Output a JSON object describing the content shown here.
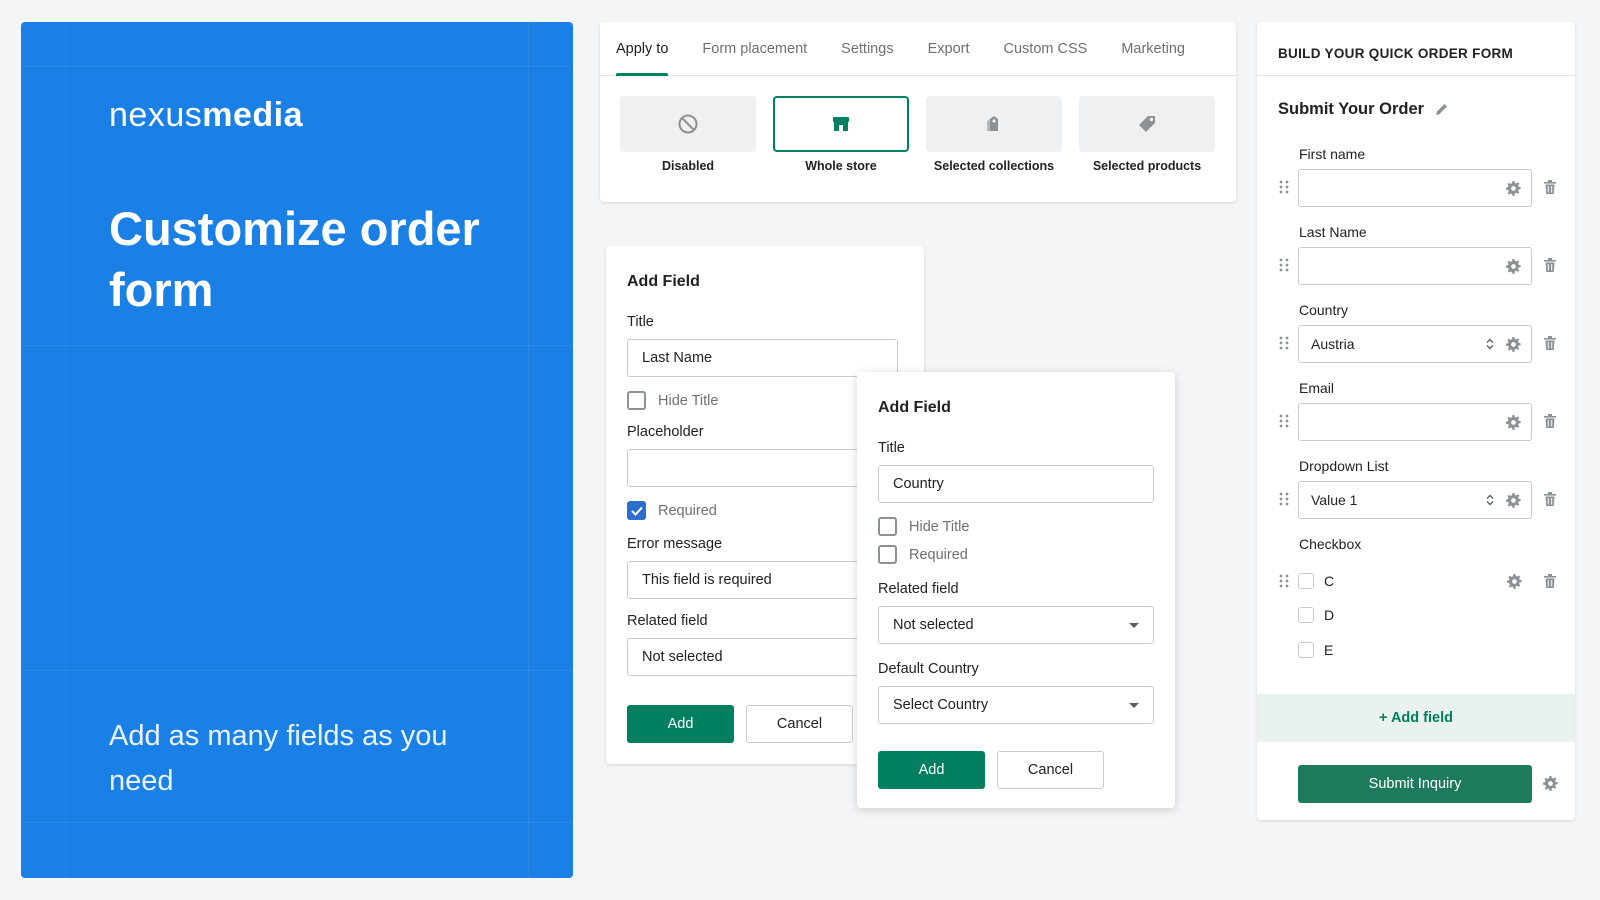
{
  "hero": {
    "logo_light": "nexus",
    "logo_bold": "media",
    "title": "Customize order form",
    "subtitle": "Add as many fields as you need"
  },
  "tabs": [
    "Apply to",
    "Form placement",
    "Settings",
    "Export",
    "Custom CSS",
    "Marketing"
  ],
  "apply_options": [
    {
      "label": "Disabled",
      "icon": "disabled-icon"
    },
    {
      "label": "Whole store",
      "icon": "store-icon",
      "selected": true
    },
    {
      "label": "Selected collections",
      "icon": "collections-icon"
    },
    {
      "label": "Selected products",
      "icon": "tag-icon"
    }
  ],
  "add_field_1": {
    "heading": "Add Field",
    "title_label": "Title",
    "title_value": "Last Name",
    "hide_title_label": "Hide Title",
    "placeholder_label": "Placeholder",
    "placeholder_value": "",
    "required_label": "Required",
    "required_checked": true,
    "error_label": "Error message",
    "error_value": "This field is required",
    "related_label": "Related field",
    "related_value": "Not selected",
    "add_label": "Add",
    "cancel_label": "Cancel"
  },
  "add_field_2": {
    "heading": "Add Field",
    "title_label": "Title",
    "title_value": "Country",
    "hide_title_label": "Hide Title",
    "required_label": "Required",
    "related_label": "Related field",
    "related_value": "Not selected",
    "default_country_label": "Default Country",
    "default_country_value": "Select Country",
    "add_label": "Add",
    "cancel_label": "Cancel"
  },
  "builder": {
    "header": "BUILD YOUR QUICK ORDER FORM",
    "form_title": "Submit Your Order",
    "fields": {
      "first_name": {
        "label": "First name",
        "value": ""
      },
      "last_name": {
        "label": "Last Name",
        "value": ""
      },
      "country": {
        "label": "Country",
        "value": "Austria"
      },
      "email": {
        "label": "Email",
        "value": ""
      },
      "dropdown": {
        "label": "Dropdown List",
        "value": "Value 1"
      },
      "checkbox": {
        "label": "Checkbox",
        "options": [
          "C",
          "D",
          "E"
        ]
      }
    },
    "add_field_label": "+ Add field",
    "submit_label": "Submit Inquiry"
  },
  "colors": {
    "hero_blue": "#1a80e6",
    "primary_green": "#008060",
    "checkbox_blue": "#2c6ecb"
  }
}
